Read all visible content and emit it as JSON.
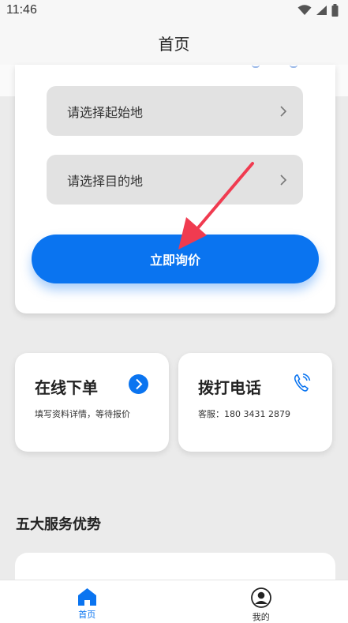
{
  "status": {
    "time": "11:46"
  },
  "header": {
    "title": "首页"
  },
  "form": {
    "origin_placeholder": "请选择起始地",
    "destination_placeholder": "请选择目的地",
    "submit_label": "立即询价"
  },
  "cards": {
    "order": {
      "title": "在线下单",
      "subtitle": "填写资料详情，等待报价"
    },
    "call": {
      "title": "拨打电话",
      "subtitle": "客服：180 3431 2879"
    }
  },
  "section": {
    "title": "五大服务优势"
  },
  "tabbar": {
    "items": [
      {
        "label": "首页",
        "icon": "home-icon",
        "active": true
      },
      {
        "label": "我的",
        "icon": "user-icon",
        "active": false
      }
    ]
  },
  "colors": {
    "primary": "#0a74f0",
    "annotation_arrow": "#f03b50"
  }
}
